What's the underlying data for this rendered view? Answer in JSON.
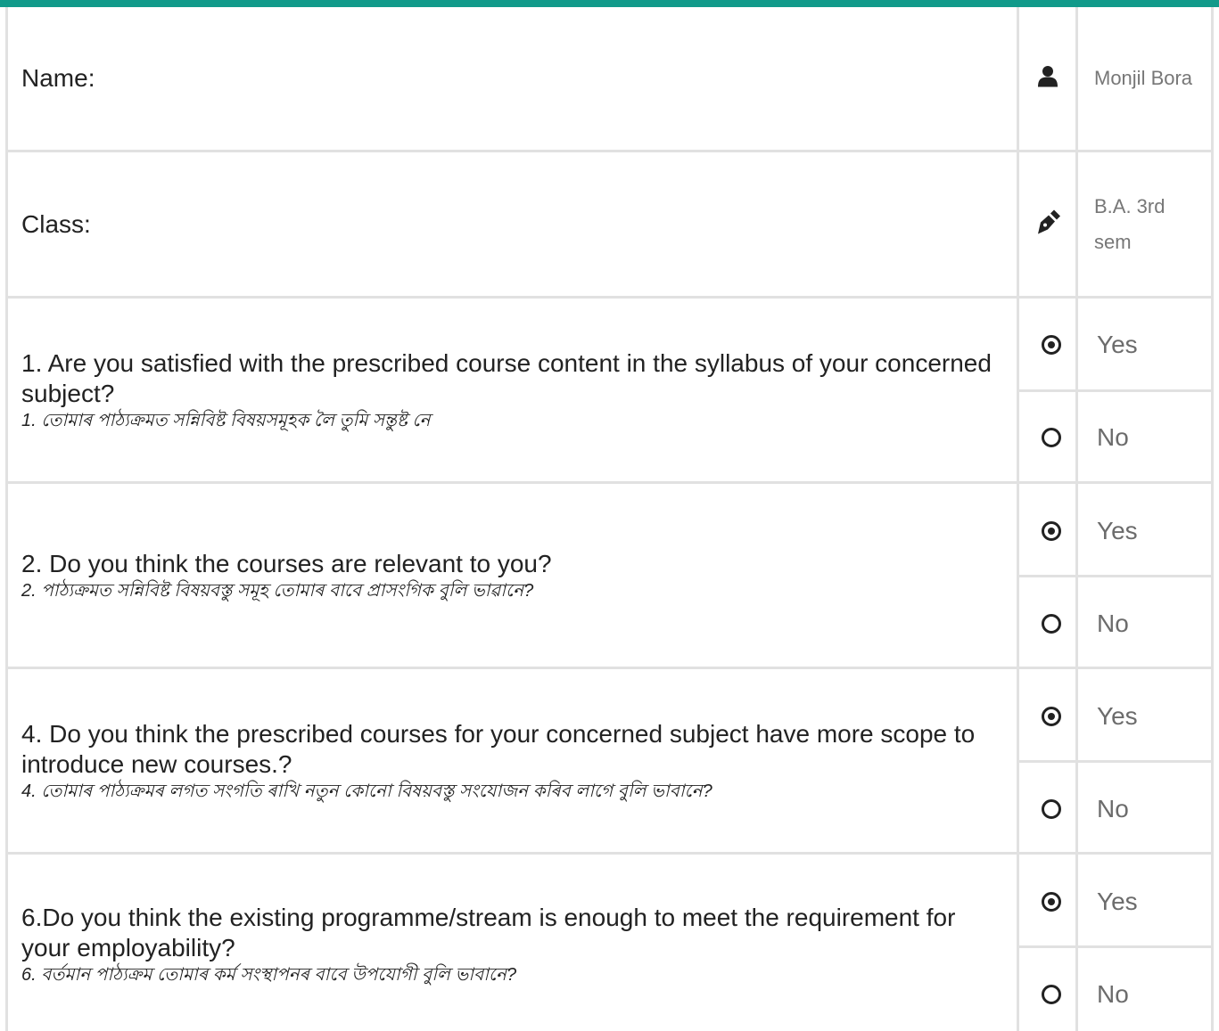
{
  "theme": {
    "accent": "#119a8a",
    "divider": "#e1e1e1",
    "value_text": "#777777"
  },
  "fields": [
    {
      "label": "Name:",
      "icon": "user-icon",
      "value": "Monjil Bora"
    },
    {
      "label": "Class:",
      "icon": "pen-icon",
      "value": "B.A. 3rd sem"
    }
  ],
  "questions": [
    {
      "text_en": "1. Are you satisfied with the prescribed course content in the syllabus of your concerned subject?",
      "text_as": "1. তোমাৰ পাঠ্যক্ৰমত সন্নিবিষ্ট বিষয়সমূহক লৈ তুমি সন্তুষ্ট নে",
      "options": [
        {
          "label": "Yes",
          "selected": true
        },
        {
          "label": "No",
          "selected": false
        }
      ]
    },
    {
      "text_en": "2. Do you think the courses are relevant to you?",
      "text_as": "2. পাঠ্যক্ৰমত সন্নিবিষ্ট বিষয়বস্তু সমূহ তোমাৰ বাবে প্ৰাসংগিক বুলি ভাৱানে?",
      "options": [
        {
          "label": "Yes",
          "selected": true
        },
        {
          "label": "No",
          "selected": false
        }
      ]
    },
    {
      "text_en": "4. Do you think the prescribed courses for your concerned subject have more scope to introduce new courses.?",
      "text_as": "4. তোমাৰ পাঠ্যক্ৰমৰ লগত সংগতি ৰাখি নতুন কোনো বিষয়বস্তু সংযোজন কৰিব লাগে বুলি ভাবানে?",
      "options": [
        {
          "label": "Yes",
          "selected": true
        },
        {
          "label": "No",
          "selected": false
        }
      ]
    },
    {
      "text_en": "6.Do you think the existing programme/stream is enough to meet the requirement for your employability?",
      "text_as": "6. বৰ্তমান পাঠ্যক্ৰম তোমাৰ কৰ্ম সংস্থাপনৰ বাবে উপযোগী বুলি ভাবানে?",
      "options": [
        {
          "label": "Yes",
          "selected": true
        },
        {
          "label": "No",
          "selected": false
        }
      ]
    }
  ]
}
